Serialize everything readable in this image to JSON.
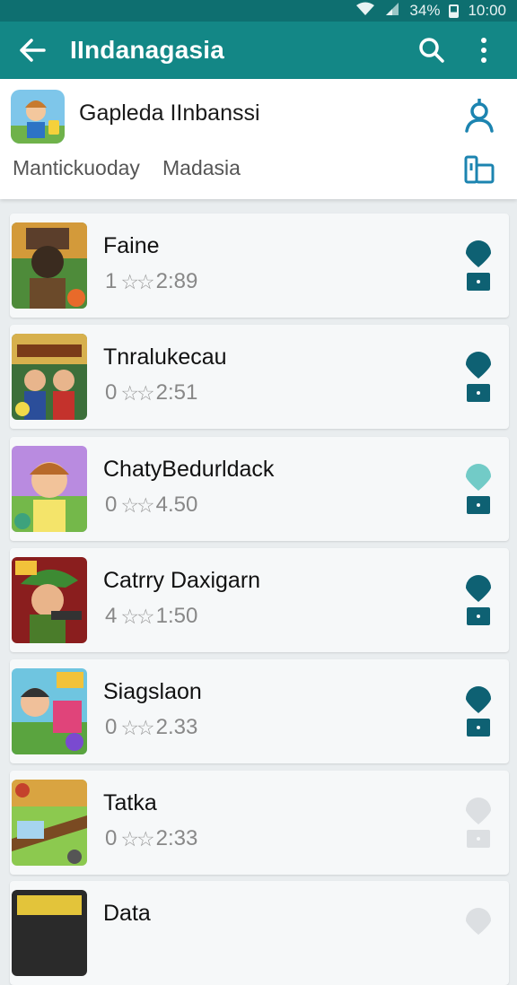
{
  "status_bar": {
    "battery": "34%",
    "time": "10:00"
  },
  "app_bar": {
    "title": "IIndanagasia"
  },
  "header": {
    "app_name": "Gapleda IInbanssi",
    "sub1": "Mantickuoday",
    "sub2": "Madasia"
  },
  "items": [
    {
      "name": "Faine",
      "count": "1",
      "stars": "☆☆",
      "score": "2:89",
      "pin_color": "#0e6173"
    },
    {
      "name": "Tnralukecau",
      "count": "0",
      "stars": "☆☆",
      "score": "2:51",
      "pin_color": "#0e6173"
    },
    {
      "name": "ChatyBedurldack",
      "count": "0",
      "stars": "☆☆",
      "score": "4.50",
      "pin_color": "#72cbc7"
    },
    {
      "name": "Catrry Daxigarn",
      "count": "4",
      "stars": "☆☆",
      "score": "1:50",
      "pin_color": "#0e6173"
    },
    {
      "name": "Siagslaon",
      "count": "0",
      "stars": "☆☆",
      "score": "2.33",
      "pin_color": "#0e6173"
    },
    {
      "name": "Tatka",
      "count": "0",
      "stars": "☆☆",
      "score": "2:33",
      "pin_color": "#dcdfe2"
    },
    {
      "name": "Data",
      "count": "",
      "stars": "",
      "score": "",
      "pin_color": "#dcdfe2"
    }
  ],
  "colors": {
    "primary": "#138786",
    "status": "#0e6f70",
    "accent": "#0e6173"
  },
  "icons": [
    "back-arrow-icon",
    "search-icon",
    "more-vert-icon",
    "person-icon",
    "device-icon",
    "location-pin-icon"
  ]
}
